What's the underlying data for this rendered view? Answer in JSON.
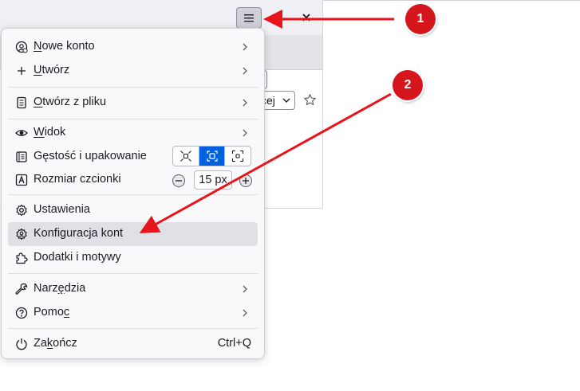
{
  "menu": {
    "items": [
      {
        "label_pre": "",
        "label_u": "N",
        "label_post": "owe konto",
        "icon": "new-account-icon",
        "submenu": true
      },
      {
        "label_pre": "",
        "label_u": "U",
        "label_post": "twórz",
        "icon": "plus-icon",
        "submenu": true
      },
      {
        "label_pre": "",
        "label_u": "O",
        "label_post": "twórz z pliku",
        "icon": "file-open-icon",
        "submenu": true
      },
      {
        "label_pre": "",
        "label_u": "W",
        "label_post": "idok",
        "icon": "eye-icon",
        "submenu": true
      },
      {
        "label": "Gęstość i upakowanie",
        "icon": "density-icon"
      },
      {
        "label": "Rozmiar czcionki",
        "icon": "font-size-icon"
      },
      {
        "label": "Ustawienia",
        "icon": "gear-icon"
      },
      {
        "label": "Konfiguracja kont",
        "icon": "account-settings-icon"
      },
      {
        "label": "Dodatki i motywy",
        "icon": "puzzle-icon"
      },
      {
        "label_pre": "Narz",
        "label_u": "ę",
        "label_post": "dzia",
        "icon": "wrench-icon",
        "submenu": true
      },
      {
        "label_pre": "Pomo",
        "label_u": "c",
        "label_post": "",
        "icon": "help-icon",
        "submenu": true
      },
      {
        "label_pre": "Za",
        "label_u": "k",
        "label_post": "ończ",
        "icon": "power-icon",
        "shortcut": "Ctrl+Q"
      }
    ],
    "font_size_value": "15 px"
  },
  "background": {
    "sort_fragment": "cej"
  },
  "annotations": {
    "badge1": "1",
    "badge2": "2",
    "arrow_color": "#e8141b"
  },
  "colors": {
    "accent": "#0061e0",
    "highlight": "#e0e0e6",
    "badge": "#d6161d"
  }
}
